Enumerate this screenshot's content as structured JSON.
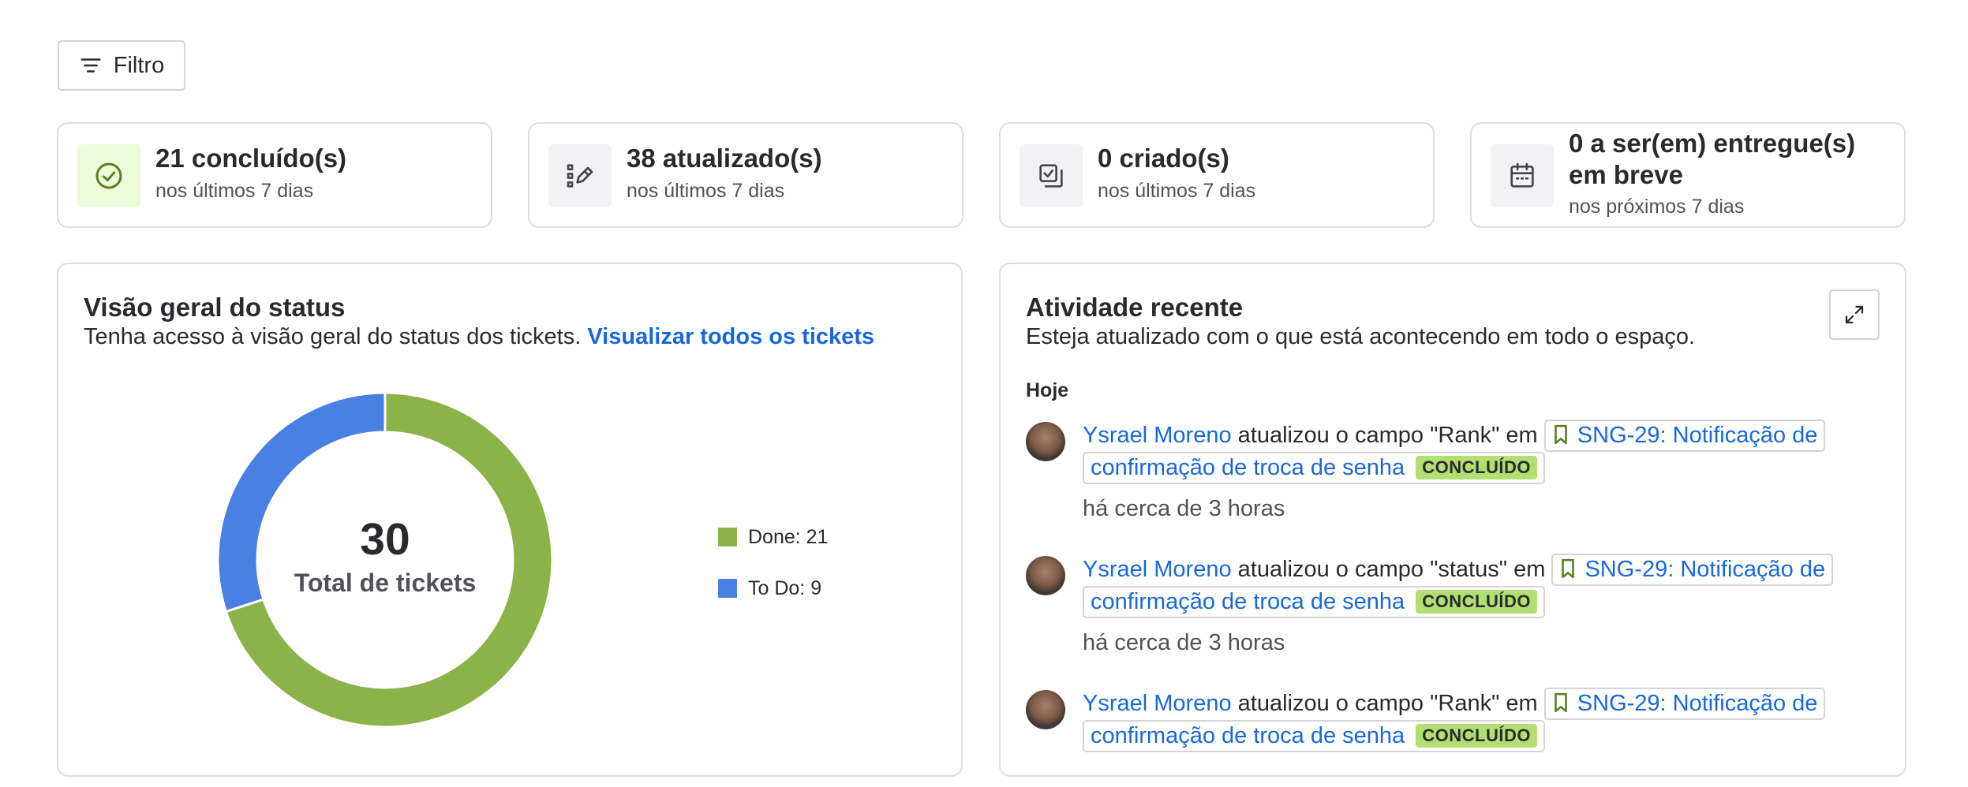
{
  "filter": {
    "label": "Filtro",
    "icon": "filter-icon"
  },
  "stats": [
    {
      "title": "21 concluído(s)",
      "subtitle": "nos últimos 7 dias",
      "icon": "check-circle-icon"
    },
    {
      "title": "38 atualizado(s)",
      "subtitle": "nos últimos 7 dias",
      "icon": "edit-list-icon"
    },
    {
      "title": "0 criado(s)",
      "subtitle": "nos últimos 7 dias",
      "icon": "copy-check-icon"
    },
    {
      "title": "0 a ser(em) entregue(s) em breve",
      "subtitle": "nos próximos 7 dias",
      "icon": "calendar-icon"
    }
  ],
  "status_overview": {
    "title": "Visão geral do status",
    "description": "Tenha acesso à visão geral do status dos tickets.",
    "link": "Visualizar todos os tickets",
    "total_value": "30",
    "total_label": "Total de tickets",
    "legend": [
      {
        "label": "Done: 21",
        "color": "#8bb34a"
      },
      {
        "label": "To Do: 9",
        "color": "#4a7fe3"
      }
    ]
  },
  "chart_data": {
    "type": "pie",
    "donut": true,
    "categories": [
      "Done",
      "To Do"
    ],
    "values": [
      21,
      9
    ],
    "colors": [
      "#8bb34a",
      "#4a7fe3"
    ],
    "legend_position": "right"
  },
  "recent_activity": {
    "title": "Atividade recente",
    "description": "Esteja atualizado com o que está acontecendo em todo o espaço.",
    "expand_icon": "expand-icon",
    "day": "Hoje",
    "items": [
      {
        "user": "Ysrael Moreno",
        "action": " atualizou o campo \"Rank\" em ",
        "ticket": "SNG-29: Notificação de confirmação de troca de senha",
        "status": "CONCLUÍDO",
        "time": "há cerca de 3 horas"
      },
      {
        "user": "Ysrael Moreno",
        "action": " atualizou o campo \"status\" em ",
        "ticket": "SNG-29: Notificação de confirmação de troca de senha",
        "status": "CONCLUÍDO",
        "time": "há cerca de 3 horas"
      },
      {
        "user": "Ysrael Moreno",
        "action": " atualizou o campo \"Rank\" em ",
        "ticket": "SNG-29: Notificação de confirmação de troca de senha",
        "status": "CONCLUÍDO",
        "time": ""
      }
    ]
  }
}
